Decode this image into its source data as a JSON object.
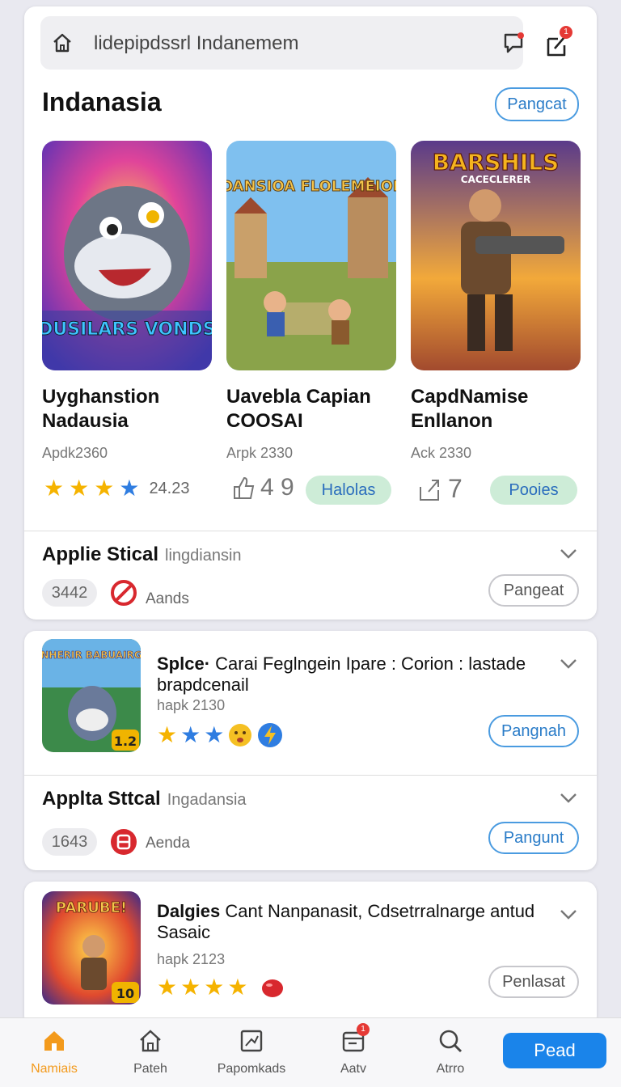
{
  "search": {
    "placeholder": "lidepipdssrl Indanemem"
  },
  "notification_badge": "1",
  "section": {
    "title": "Indanasia",
    "button_label": "Pangcat"
  },
  "featured": [
    {
      "art_title": "BDUSILARS VONDSA",
      "name_line1": "Uyghanstion",
      "name_line2": "Nadausia",
      "meta": "Apdk2360",
      "rating_text": "24.23"
    },
    {
      "art_title": "ROANSIOA FLOLEMEIOES",
      "name_line1": "Uavebla Capian",
      "name_line2": "COOSAI",
      "meta": "Arpk 2330",
      "icon_text": "4 9",
      "pill_label": "Halolas"
    },
    {
      "art_title": "BARSHILS",
      "art_subtitle": "CACECLERER",
      "name_line1": "CapdNamise",
      "name_line2": "Enllanon",
      "meta": "Ack 2330",
      "icon_text": "7",
      "pill_label": "Pooies"
    }
  ],
  "row1": {
    "title": "Applie Stical",
    "subtitle": "lingdiansin",
    "count": "3442",
    "label": "Aands",
    "button": "Pangeat"
  },
  "app1": {
    "icon_text": "SNHERIR BABUAIRGS",
    "icon_badge": "1.2",
    "title_bold": "Splce·",
    "title_rest": " Carai  Feglngein  Ipare : Corion : lastade brapdcenail",
    "meta": "hapk 2130",
    "button": "Pangnah"
  },
  "row2": {
    "title": "Applta Sttcal",
    "subtitle": "Ingadansia",
    "count": "1643",
    "label": "Aenda",
    "button": "Pangunt"
  },
  "app2": {
    "icon_text": "PARUBE!",
    "icon_badge": "10",
    "title_bold": "Dalgies",
    "title_rest": " Cant Nanpanasit, Cdsetrralnarge antud Sasaic",
    "meta": "hapk 2123",
    "button": "Penlasat"
  },
  "nav": {
    "items": [
      "Namiais",
      "Pateh",
      "Papomkads",
      "Aatv",
      "Atrro"
    ],
    "nav_badge": "1",
    "primary": "Pead"
  },
  "colors": {
    "accent": "#1a84ea",
    "active_nav": "#f39a1c",
    "pill_green": "#cdecd7"
  }
}
